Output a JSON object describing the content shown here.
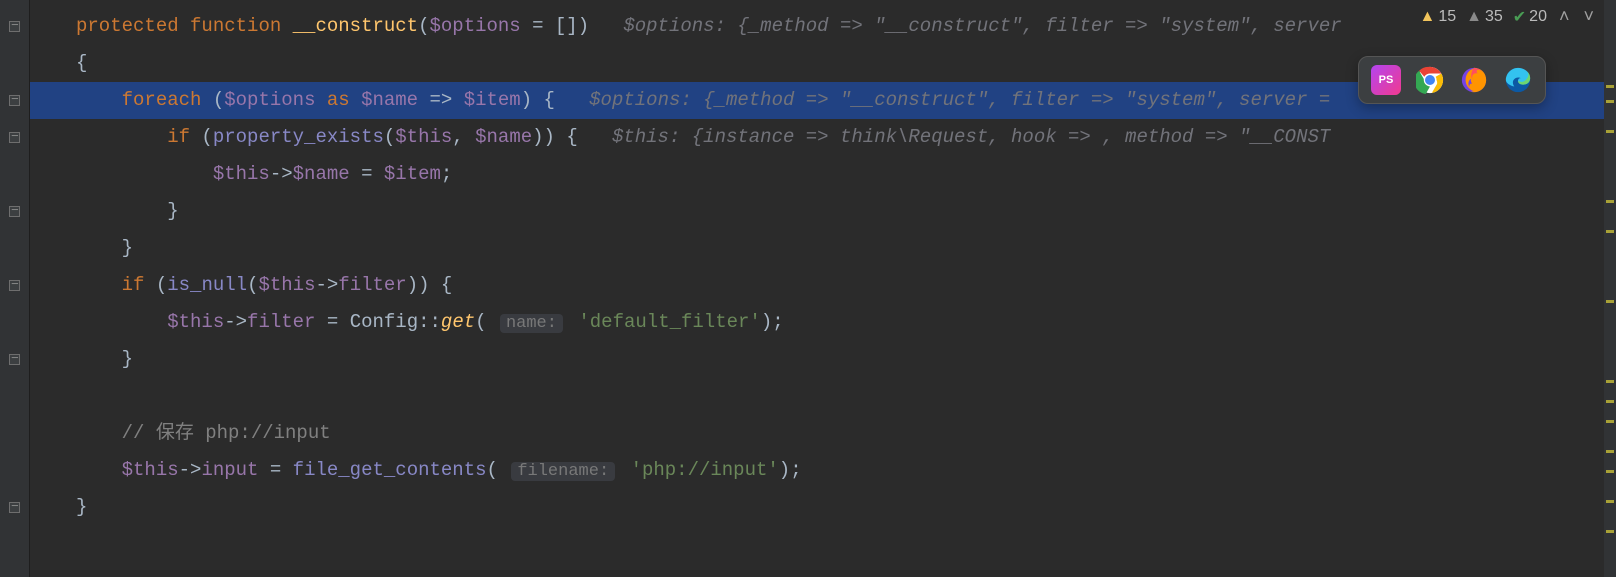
{
  "inspection": {
    "warn_count": "15",
    "weak_count": "35",
    "ok_count": "20"
  },
  "taskbar_apps": [
    "phpstorm",
    "chrome",
    "firefox",
    "edge"
  ],
  "code": {
    "l1": {
      "kw1": "protected",
      "kw2": "function",
      "fn": "__construct",
      "paren_open": "(",
      "var": "$options",
      "eq": " = []",
      "paren_close": ")",
      "hint": "$options: {_method => \"__construct\", filter => \"system\", server"
    },
    "l2": {
      "brace": "{"
    },
    "l3": {
      "kw": "foreach",
      "po": " (",
      "var1": "$options",
      "as": " as ",
      "var2": "$name",
      "arr": " => ",
      "var3": "$item",
      "pc": ") {",
      "hint": "$options: {_method => \"__construct\", filter => \"system\", server ="
    },
    "l4": {
      "kw": "if",
      "po": " (",
      "builtin": "property_exists",
      "po2": "(",
      "var1": "$this",
      "comma": ", ",
      "var2": "$name",
      "pc": ")) {",
      "hint": "$this: {instance => think\\Request, hook => , method => \"__CONST"
    },
    "l5": {
      "var1": "$this",
      "arrow": "->",
      "var2": "$name",
      "eq": " = ",
      "var3": "$item",
      "semi": ";"
    },
    "l6": {
      "brace": "}"
    },
    "l7": {
      "brace": "}"
    },
    "l8": {
      "kw": "if",
      "po": " (",
      "builtin": "is_null",
      "po2": "(",
      "var": "$this",
      "arrow": "->",
      "prop": "filter",
      "pc": ")) {"
    },
    "l9": {
      "var": "$this",
      "arrow": "->",
      "prop": "filter",
      "eq": " = ",
      "cls": "Config",
      "dcolon": "::",
      "method": "get",
      "po": "(",
      "param_hint": "name:",
      "str": "'default_filter'",
      "pc": ");"
    },
    "l10": {
      "brace": "}"
    },
    "l11_blank": "",
    "l12": {
      "comment": "// 保存 php://input"
    },
    "l13": {
      "var": "$this",
      "arrow": "->",
      "prop": "input",
      "eq": " = ",
      "builtin": "file_get_contents",
      "po": "(",
      "param_hint": "filename:",
      "str": "'php://input'",
      "pc": ");"
    },
    "l14": {
      "brace": "}"
    }
  }
}
